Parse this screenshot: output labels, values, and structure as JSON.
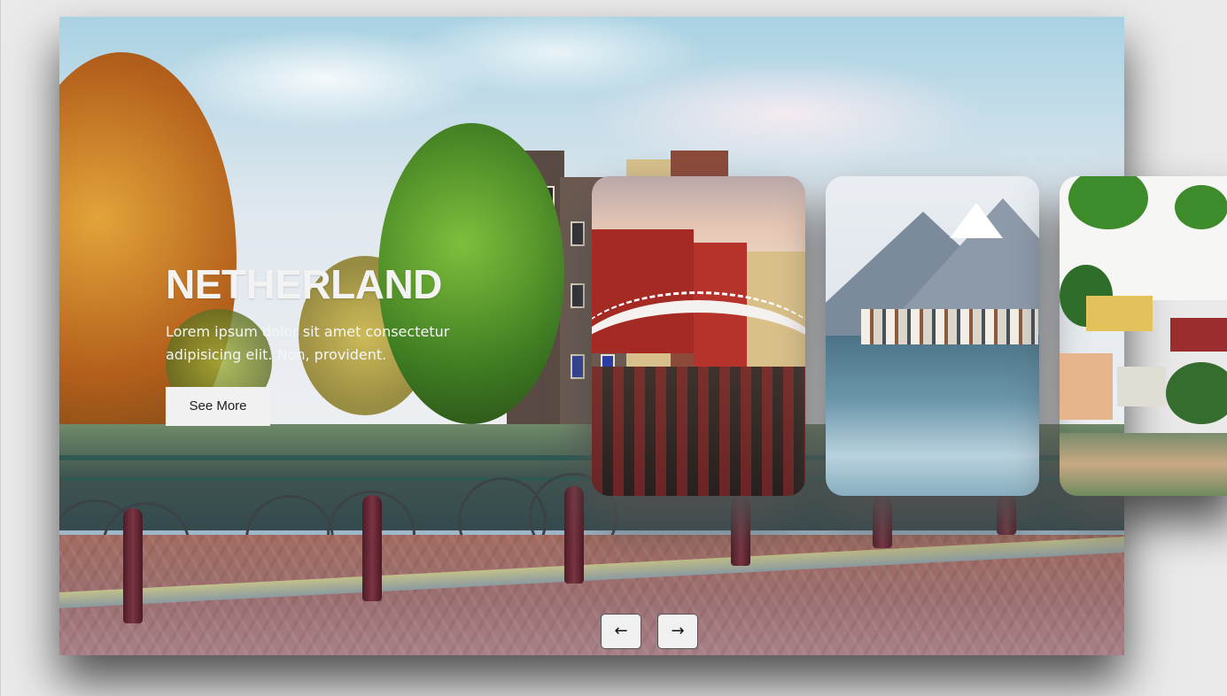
{
  "active_slide": {
    "name": "NETHERLAND",
    "description": "Lorem ipsum dolor sit amet consectetur adipisicing elit. Non, provident.",
    "button_label": "See More"
  },
  "thumbnails": [
    {
      "scene": "city-bridge-over-canal"
    },
    {
      "scene": "mountain-lake-village"
    },
    {
      "scene": "lakeside-town-houses"
    }
  ],
  "navigation": {
    "prev_label": "←",
    "next_label": "→"
  },
  "colors": {
    "page_background": "#eaeaea",
    "button_background": "#f1f1f1",
    "title_color": "#f3f3f3"
  }
}
